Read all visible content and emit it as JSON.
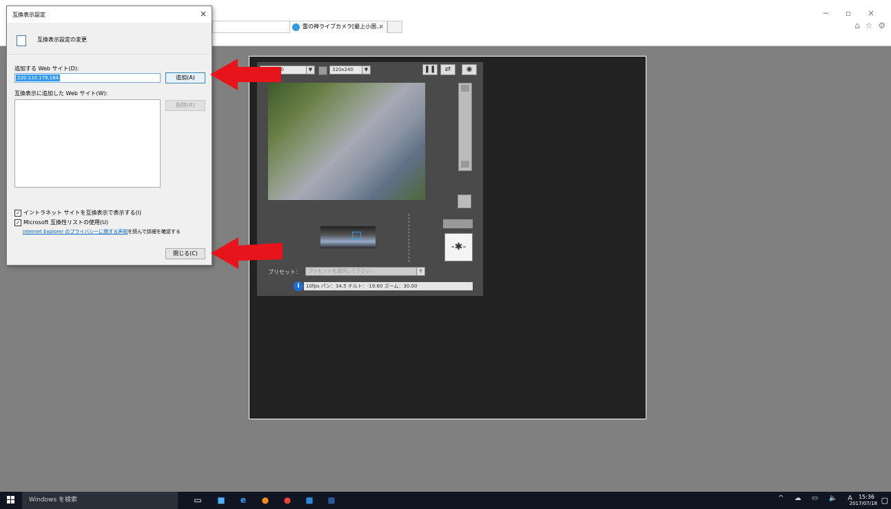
{
  "browser": {
    "tab_title": "雷の神ライブカメラ[最上小国...",
    "tab_close": "×",
    "address_search_icon": "⌕",
    "address_refresh_icon": "↻",
    "window_controls": "− ▫ ×",
    "command_icons": "⌂ ☆ ⚙"
  },
  "viewer": {
    "resolution_value": "640x480",
    "size_value": "320x240",
    "pause_icon": "❚❚",
    "swap_icon": "⇄",
    "snapshot_icon": "◉",
    "ptz_icon": "-✱-",
    "preset_label": "プリセット：",
    "preset_placeholder": "プリセットを選択して下さい。",
    "status_text": "10fps パン：34.5 チルト：-19.60 ズーム：30.00",
    "info_icon": "i"
  },
  "dialog": {
    "title": "互換表示設定",
    "close_icon": "×",
    "heading": "互換表示設定の変更",
    "add_label": "追加する Web サイト(D):",
    "add_value": "220.110.178.164",
    "add_button": "追加(A)",
    "list_label": "互換表示に追加した Web サイト(W):",
    "delete_button": "削除(R)",
    "checkbox1": "イントラネット サイトを互換表示で表示する(I)",
    "checkbox2": "Microsoft 互換性リストの使用(U)",
    "check_mark": "✓",
    "privacy_link": "Internet Explorer のプライバシーに関する声明",
    "privacy_rest": "を読んで詳細を確認する",
    "close_button": "閉じる(C)"
  },
  "taskbar": {
    "search_text": "Windows を検索",
    "tray": "^ ☁ ▭ 🔈 A",
    "time": "15:36",
    "date": "2017/07/18",
    "notification_icon": "▢"
  },
  "colors": {
    "arrow": "#e8141c",
    "link": "#0066cc",
    "accent": "#3399ff"
  }
}
